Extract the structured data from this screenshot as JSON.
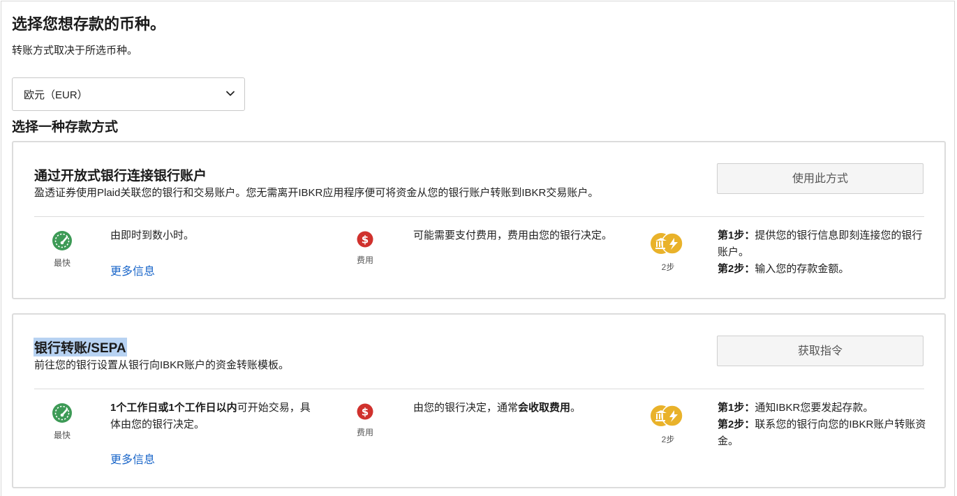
{
  "page": {
    "title": "选择您想存款的币种。",
    "subtitle": "转账方式取决于所选币种。",
    "currency_select": {
      "value": "欧元（EUR）"
    },
    "methods_heading": "选择一种存款方式"
  },
  "colors": {
    "speed_icon": "#3d9a56",
    "fee_icon": "#d0312d",
    "steps_icon": "#e9b22a",
    "link": "#1a66c9",
    "selection_highlight": "#b7d2f2"
  },
  "methods": [
    {
      "title": "通过开放式银行连接银行账户",
      "description": "盈透证券使用Plaid关联您的银行和交易账户。您无需离开IBKR应用程序便可将资金从您的银行账户转账到IBKR交易账户。",
      "button_label": "使用此方式",
      "speed": {
        "icon": "speedometer-icon",
        "caption": "最快",
        "text": "由即时到数小时。",
        "more_link": "更多信息"
      },
      "fee": {
        "icon": "dollar-icon",
        "caption": "费用",
        "text": "可能需要支付费用，费用由您的银行决定。"
      },
      "steps": {
        "icon": "bank-steps-icon",
        "caption": "2步",
        "step1_label": "第1步：",
        "step1_text": "提供您的银行信息即刻连接您的银行账户。",
        "step2_label": "第2步：",
        "step2_text": "输入您的存款金额。"
      }
    },
    {
      "title": "银行转账/SEPA",
      "description": "前往您的银行设置从银行向IBKR账户的资金转账模板。",
      "button_label": "获取指令",
      "speed": {
        "icon": "speedometer-icon",
        "caption": "最快",
        "text_bold": "1个工作日或1个工作日以内",
        "text_rest": "可开始交易，具体由您的银行决定。",
        "more_link": "更多信息"
      },
      "fee": {
        "icon": "dollar-icon",
        "caption": "费用",
        "text_plain": "由您的银行决定，通常",
        "text_bold": "会收取费用",
        "text_end": "。"
      },
      "steps": {
        "icon": "bank-steps-icon",
        "caption": "2步",
        "step1_label": "第1步：",
        "step1_text": "通知IBKR您要发起存款。",
        "step2_label": "第2步：",
        "step2_text": "联系您的银行向您的IBKR账户转账资金。"
      }
    }
  ]
}
